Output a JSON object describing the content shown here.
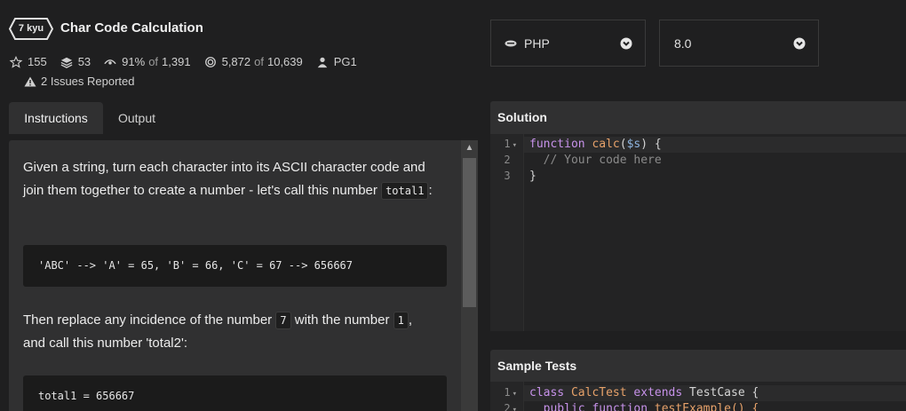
{
  "kata": {
    "rank": "7 kyu",
    "title": "Char Code Calculation"
  },
  "stats": {
    "stars": "155",
    "collections": "53",
    "satisfaction": "91%",
    "satisfaction_of": "of",
    "satisfaction_total": "1,391",
    "completions": "5,872",
    "completions_of": "of",
    "completions_total": "10,639",
    "author": "PG1",
    "issues": "2 Issues Reported"
  },
  "tabs": {
    "instructions": "Instructions",
    "output": "Output"
  },
  "instructions": {
    "p1_text": "Given a string, turn each character into its ASCII character code and join them together to create a number - let's call this number",
    "p1_code": "total1",
    "p1_end": ":",
    "code_example": "'ABC' --> 'A' = 65, 'B' = 66, 'C' = 67 --> 656667",
    "p2_a": "Then replace any incidence of the number",
    "p2_code1": "7",
    "p2_b": "with the number",
    "p2_code2": "1",
    "p2_c": ",",
    "p2_d": "and call this number 'total2':",
    "code_example2": "total1 = 656667"
  },
  "language": {
    "selected": "PHP",
    "version": "8.0"
  },
  "solution": {
    "title": "Solution",
    "line_numbers": [
      "1",
      "2",
      "3"
    ],
    "l1_kw": "function",
    "l1_fn": "calc",
    "l1_open": "(",
    "l1_var": "$s",
    "l1_close": ") {",
    "l2_comment": "// Your code here",
    "l3": "}"
  },
  "sample_tests": {
    "title": "Sample Tests",
    "line_numbers": [
      "1",
      "2"
    ],
    "l1_kw": "class",
    "l1_cls": "CalcTest",
    "l1_kw2": "extends",
    "l1_base": "TestCase {",
    "l2_kw": "public function",
    "l2_fn": "testExample() {"
  },
  "icons": {
    "rank": "hexagon-badge-icon",
    "stars": "star-icon",
    "collections": "layers-icon",
    "satisfaction": "eye-icon",
    "completions": "target-icon",
    "author": "user-icon",
    "issues": "warning-icon",
    "php": "php-logo-icon",
    "dropdown": "chevron-down-icon"
  }
}
